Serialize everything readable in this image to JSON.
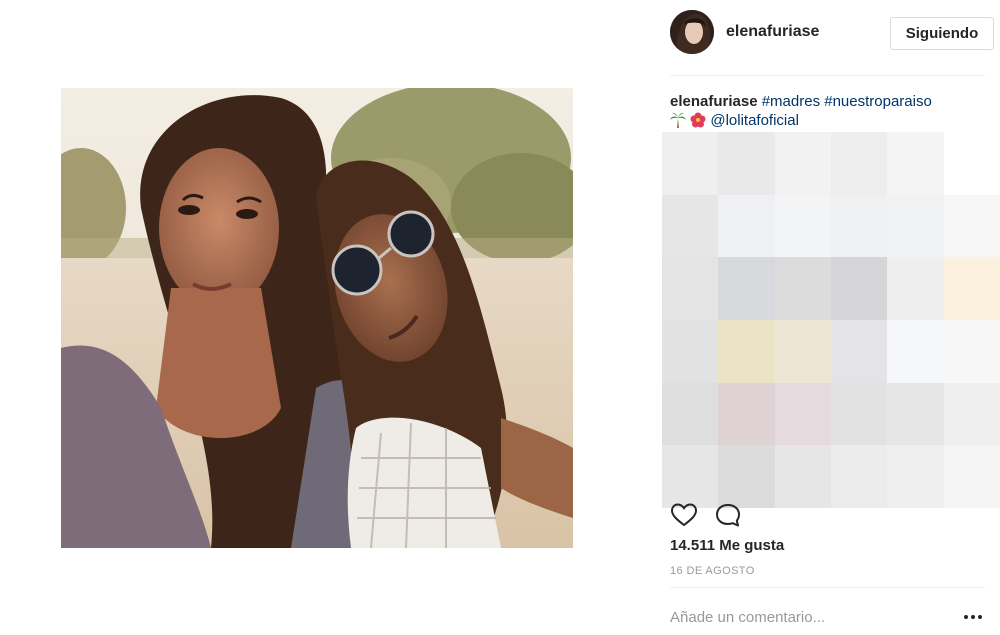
{
  "post": {
    "username": "elenafuriase",
    "follow_label": "Siguiendo",
    "caption": {
      "author": "elenafuriase",
      "hashtags": [
        "#madres",
        "#nuestroparaiso"
      ],
      "emojis": [
        "palm-tree-emoji",
        "hibiscus-emoji"
      ],
      "mention": "@lolitafoficial"
    },
    "likes_text": "14.511 Me gusta",
    "date_text": "16 DE AGOSTO",
    "comment_placeholder": "Añade un comentario...",
    "icons": {
      "like": "heart-icon",
      "comment": "comment-icon",
      "more": "more-options-icon"
    },
    "colors": {
      "link": "#003569",
      "muted": "#999999",
      "border": "#dbdbdb"
    }
  },
  "pixelated_comments": [
    "#efefef",
    "#e9e9e9",
    "#f2f2f2",
    "#ededed",
    "#f4f4f4",
    "#ffffff",
    "#e6e6e6",
    "#eef0f3",
    "#f3f4f6",
    "#eef0f2",
    "#f1f2f3",
    "#f6f6f6",
    "#e4e4e4",
    "#d8d9dc",
    "#dcdcdc",
    "#d6d6d8",
    "#eeeeee",
    "#fbf1de",
    "#e2e2e2",
    "#ebe3c6",
    "#ede5d6",
    "#e4e4e6",
    "#f6f7f9",
    "#f7f7f7",
    "#dedede",
    "#ded2d5",
    "#e5dadd",
    "#e2e2e2",
    "#e6e6e6",
    "#efefef",
    "#e6e6e6",
    "#dcdcdc",
    "#e6e6e6",
    "#ececec",
    "#efefef",
    "#f5f5f5"
  ]
}
